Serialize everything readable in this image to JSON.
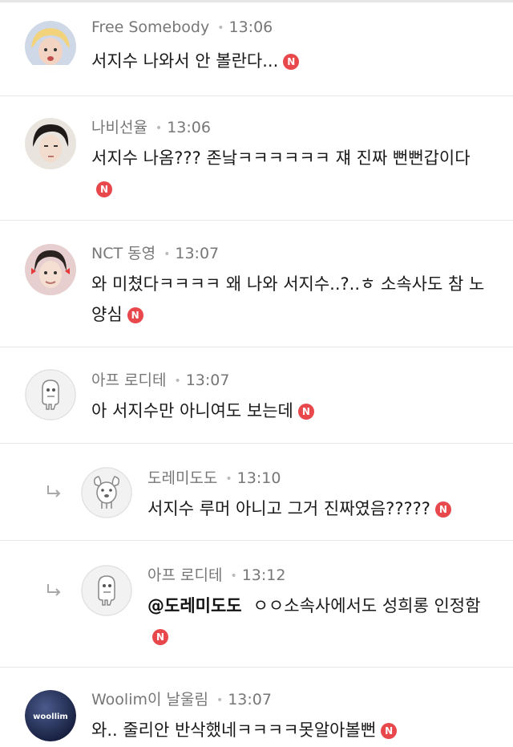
{
  "comments": [
    {
      "author": "Free Somebody",
      "time": "13:06",
      "text": "서지수 나와서 안 볼란다...",
      "badge": "N"
    },
    {
      "author": "나비선율",
      "time": "13:06",
      "text": "서지수 나옴??? 존낰ㅋㅋㅋㅋㅋㅋ 쟤 진짜 뻔뻔갑이다",
      "badge": "N"
    },
    {
      "author": "NCT 동영",
      "time": "13:07",
      "text": "와 미쳤다ㅋㅋㅋㅋ 왜 나와 서지수..?..ㅎ 소속사도 참 노양심",
      "badge": "N"
    },
    {
      "author": "아프 로디테",
      "time": "13:07",
      "text": "아 서지수만 아니여도 보는데",
      "badge": "N"
    },
    {
      "author": "도레미도도",
      "time": "13:10",
      "text": "서지수 루머 아니고 그거 진짜였음?????",
      "badge": "N"
    },
    {
      "author": "아프 로디테",
      "time": "13:12",
      "mention": "@도레미도도",
      "text": "ㅇㅇ소속사에서도 성희롱 인정함",
      "badge": "N"
    },
    {
      "author": "Woolim이 날울림",
      "time": "13:07",
      "text": "와.. 줄리안 반삭했네ㅋㅋㅋㅋ못알아볼뻔",
      "badge": "N",
      "avatar_logo": "woollim"
    }
  ],
  "colors": {
    "badge": "#e8474b",
    "meta": "#777777",
    "divider": "#e6e6e6"
  }
}
